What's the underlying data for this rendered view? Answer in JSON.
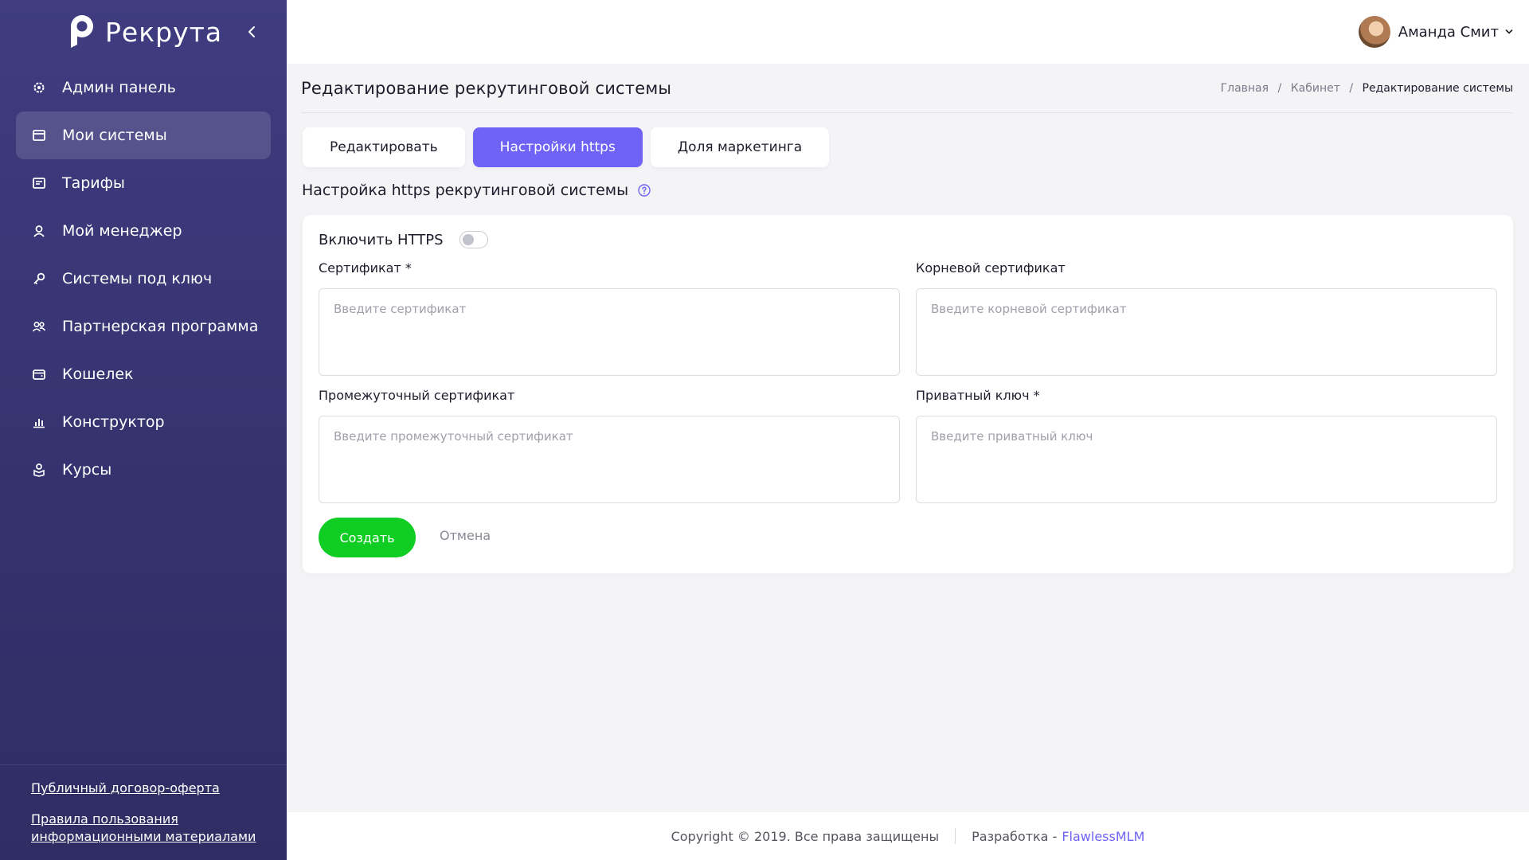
{
  "brand": {
    "name": "Рекрута",
    "logo_icon": "p-logo-icon",
    "collapse_icon": "chevron-left-icon"
  },
  "sidebar": {
    "items": [
      {
        "label": "Админ панель",
        "icon": "gear-icon"
      },
      {
        "label": "Мои системы",
        "icon": "window-icon",
        "active": true
      },
      {
        "label": "Тарифы",
        "icon": "pricing-card-icon"
      },
      {
        "label": "Мой менеджер",
        "icon": "manager-icon"
      },
      {
        "label": "Системы под ключ",
        "icon": "key-icon"
      },
      {
        "label": "Партнерская программа",
        "icon": "partners-icon"
      },
      {
        "label": "Кошелек",
        "icon": "wallet-icon"
      },
      {
        "label": "Конструктор",
        "icon": "bar-chart-icon"
      },
      {
        "label": "Курсы",
        "icon": "courses-icon"
      }
    ],
    "footer_links": [
      "Публичный договор-оферта",
      "Правила пользования информационными материалами"
    ]
  },
  "user": {
    "name": "Аманда Смит",
    "dropdown_icon": "chevron-down-icon"
  },
  "page": {
    "title": "Редактирование рекрутинговой системы",
    "breadcrumb": [
      "Главная",
      "Кабинет",
      "Редактирование системы"
    ],
    "breadcrumb_separator": "/"
  },
  "tabs": [
    {
      "label": "Редактировать"
    },
    {
      "label": "Настройки https",
      "active": true
    },
    {
      "label": "Доля маркетинга"
    }
  ],
  "section": {
    "title": "Настройка https рекрутинговой системы",
    "help_icon": "help-circle-icon"
  },
  "form": {
    "toggle_label": "Включить HTTPS",
    "toggle_on": false,
    "fields": [
      {
        "label": "Сертификат *",
        "placeholder": "Введите сертификат",
        "value": ""
      },
      {
        "label": "Корневой сертификат",
        "placeholder": "Введите корневой сертификат",
        "value": ""
      },
      {
        "label": "Промежуточный сертификат",
        "placeholder": "Введите промежуточный сертификат",
        "value": ""
      },
      {
        "label": "Приватный ключ *",
        "placeholder": "Введите приватный ключ",
        "value": ""
      }
    ],
    "submit_label": "Создать",
    "cancel_label": "Отмена"
  },
  "footer": {
    "copyright": "Copyright © 2019. Все права защищены",
    "dev_prefix": "Разработка -",
    "dev_name": "FlawlessMLM"
  },
  "colors": {
    "sidebar": "#3b3878",
    "accent": "#6e63f6",
    "success": "#0fcd22",
    "background": "#f4f4f7"
  }
}
